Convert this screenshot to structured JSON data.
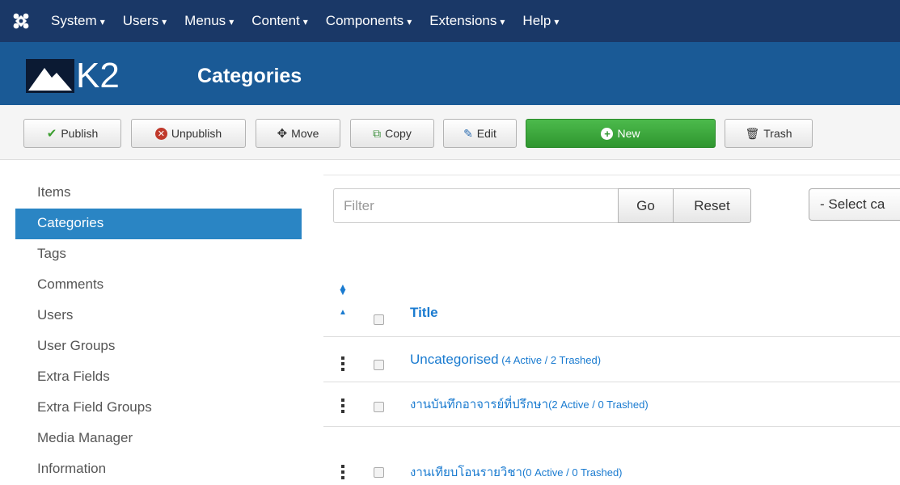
{
  "topmenu": {
    "items": [
      {
        "label": "System"
      },
      {
        "label": "Users"
      },
      {
        "label": "Menus"
      },
      {
        "label": "Content"
      },
      {
        "label": "Components"
      },
      {
        "label": "Extensions"
      },
      {
        "label": "Help"
      }
    ],
    "caret": "▾"
  },
  "brand": {
    "logo_text": "K2"
  },
  "page": {
    "title": "Categories"
  },
  "toolbar": {
    "publish": "Publish",
    "unpublish": "Unpublish",
    "move": "Move",
    "copy": "Copy",
    "edit": "Edit",
    "new": "New",
    "trash": "Trash"
  },
  "sidebar": {
    "items": [
      {
        "label": "Items"
      },
      {
        "label": "Categories"
      },
      {
        "label": "Tags"
      },
      {
        "label": "Comments"
      },
      {
        "label": "Users"
      },
      {
        "label": "User Groups"
      },
      {
        "label": "Extra Fields"
      },
      {
        "label": "Extra Field Groups"
      },
      {
        "label": "Media Manager"
      },
      {
        "label": "Information"
      }
    ],
    "active": "Categories"
  },
  "filters": {
    "search_placeholder": "Filter",
    "go": "Go",
    "reset": "Reset",
    "select_category": "- Select ca"
  },
  "table": {
    "title_header": "Title",
    "rows": [
      {
        "name": "Uncategorised",
        "counts": " (4 Active / 2 Trashed)"
      },
      {
        "name": "งานบันทึกอาจารย์ที่ปรึกษา",
        "counts": "(2 Active / 0 Trashed)"
      },
      {
        "name": "งานเทียบโอนรายวิชา",
        "counts": "(0 Active / 0 Trashed)"
      }
    ]
  },
  "colors": {
    "topbar": "#1a3867",
    "header": "#1a5a96",
    "accent": "#2a85c4",
    "link": "#1a7bd0",
    "new_button": "#3aa83a"
  }
}
